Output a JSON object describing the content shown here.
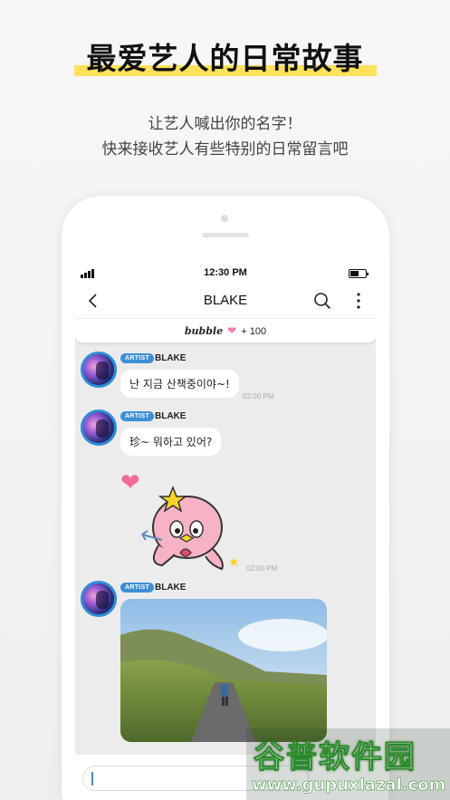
{
  "promo": {
    "headline": "最爱艺人的日常故事",
    "subtitle_line1": "让艺人喊出你的名字！",
    "subtitle_line2": "快来接收艺人有些特别的日常留言吧"
  },
  "status_bar": {
    "time": "12:30 PM"
  },
  "nav": {
    "title": "BLAKE"
  },
  "bubble_bar": {
    "label": "bubble",
    "count": "+ 100"
  },
  "messages": [
    {
      "tag": "ARTIST",
      "sender": "BLAKE",
      "text": "난 지금 산책중이야~!",
      "time": "02:00 PM"
    },
    {
      "tag": "ARTIST",
      "sender": "BLAKE",
      "text": "珍~ 뭐하고 있어?"
    },
    {
      "time": "02:00 PM"
    },
    {
      "tag": "ARTIST",
      "sender": "BLAKE"
    }
  ],
  "watermark": {
    "line1": "谷普软件园",
    "line2": "www.gupuxlazal.com"
  },
  "colors": {
    "accent": "#3d8fd6",
    "highlight": "#ffe15a",
    "heart": "#f46a93"
  },
  "icons": [
    "back-arrow-icon",
    "search-icon",
    "more-vertical-icon",
    "heart-icon",
    "signal-icon",
    "battery-icon"
  ]
}
